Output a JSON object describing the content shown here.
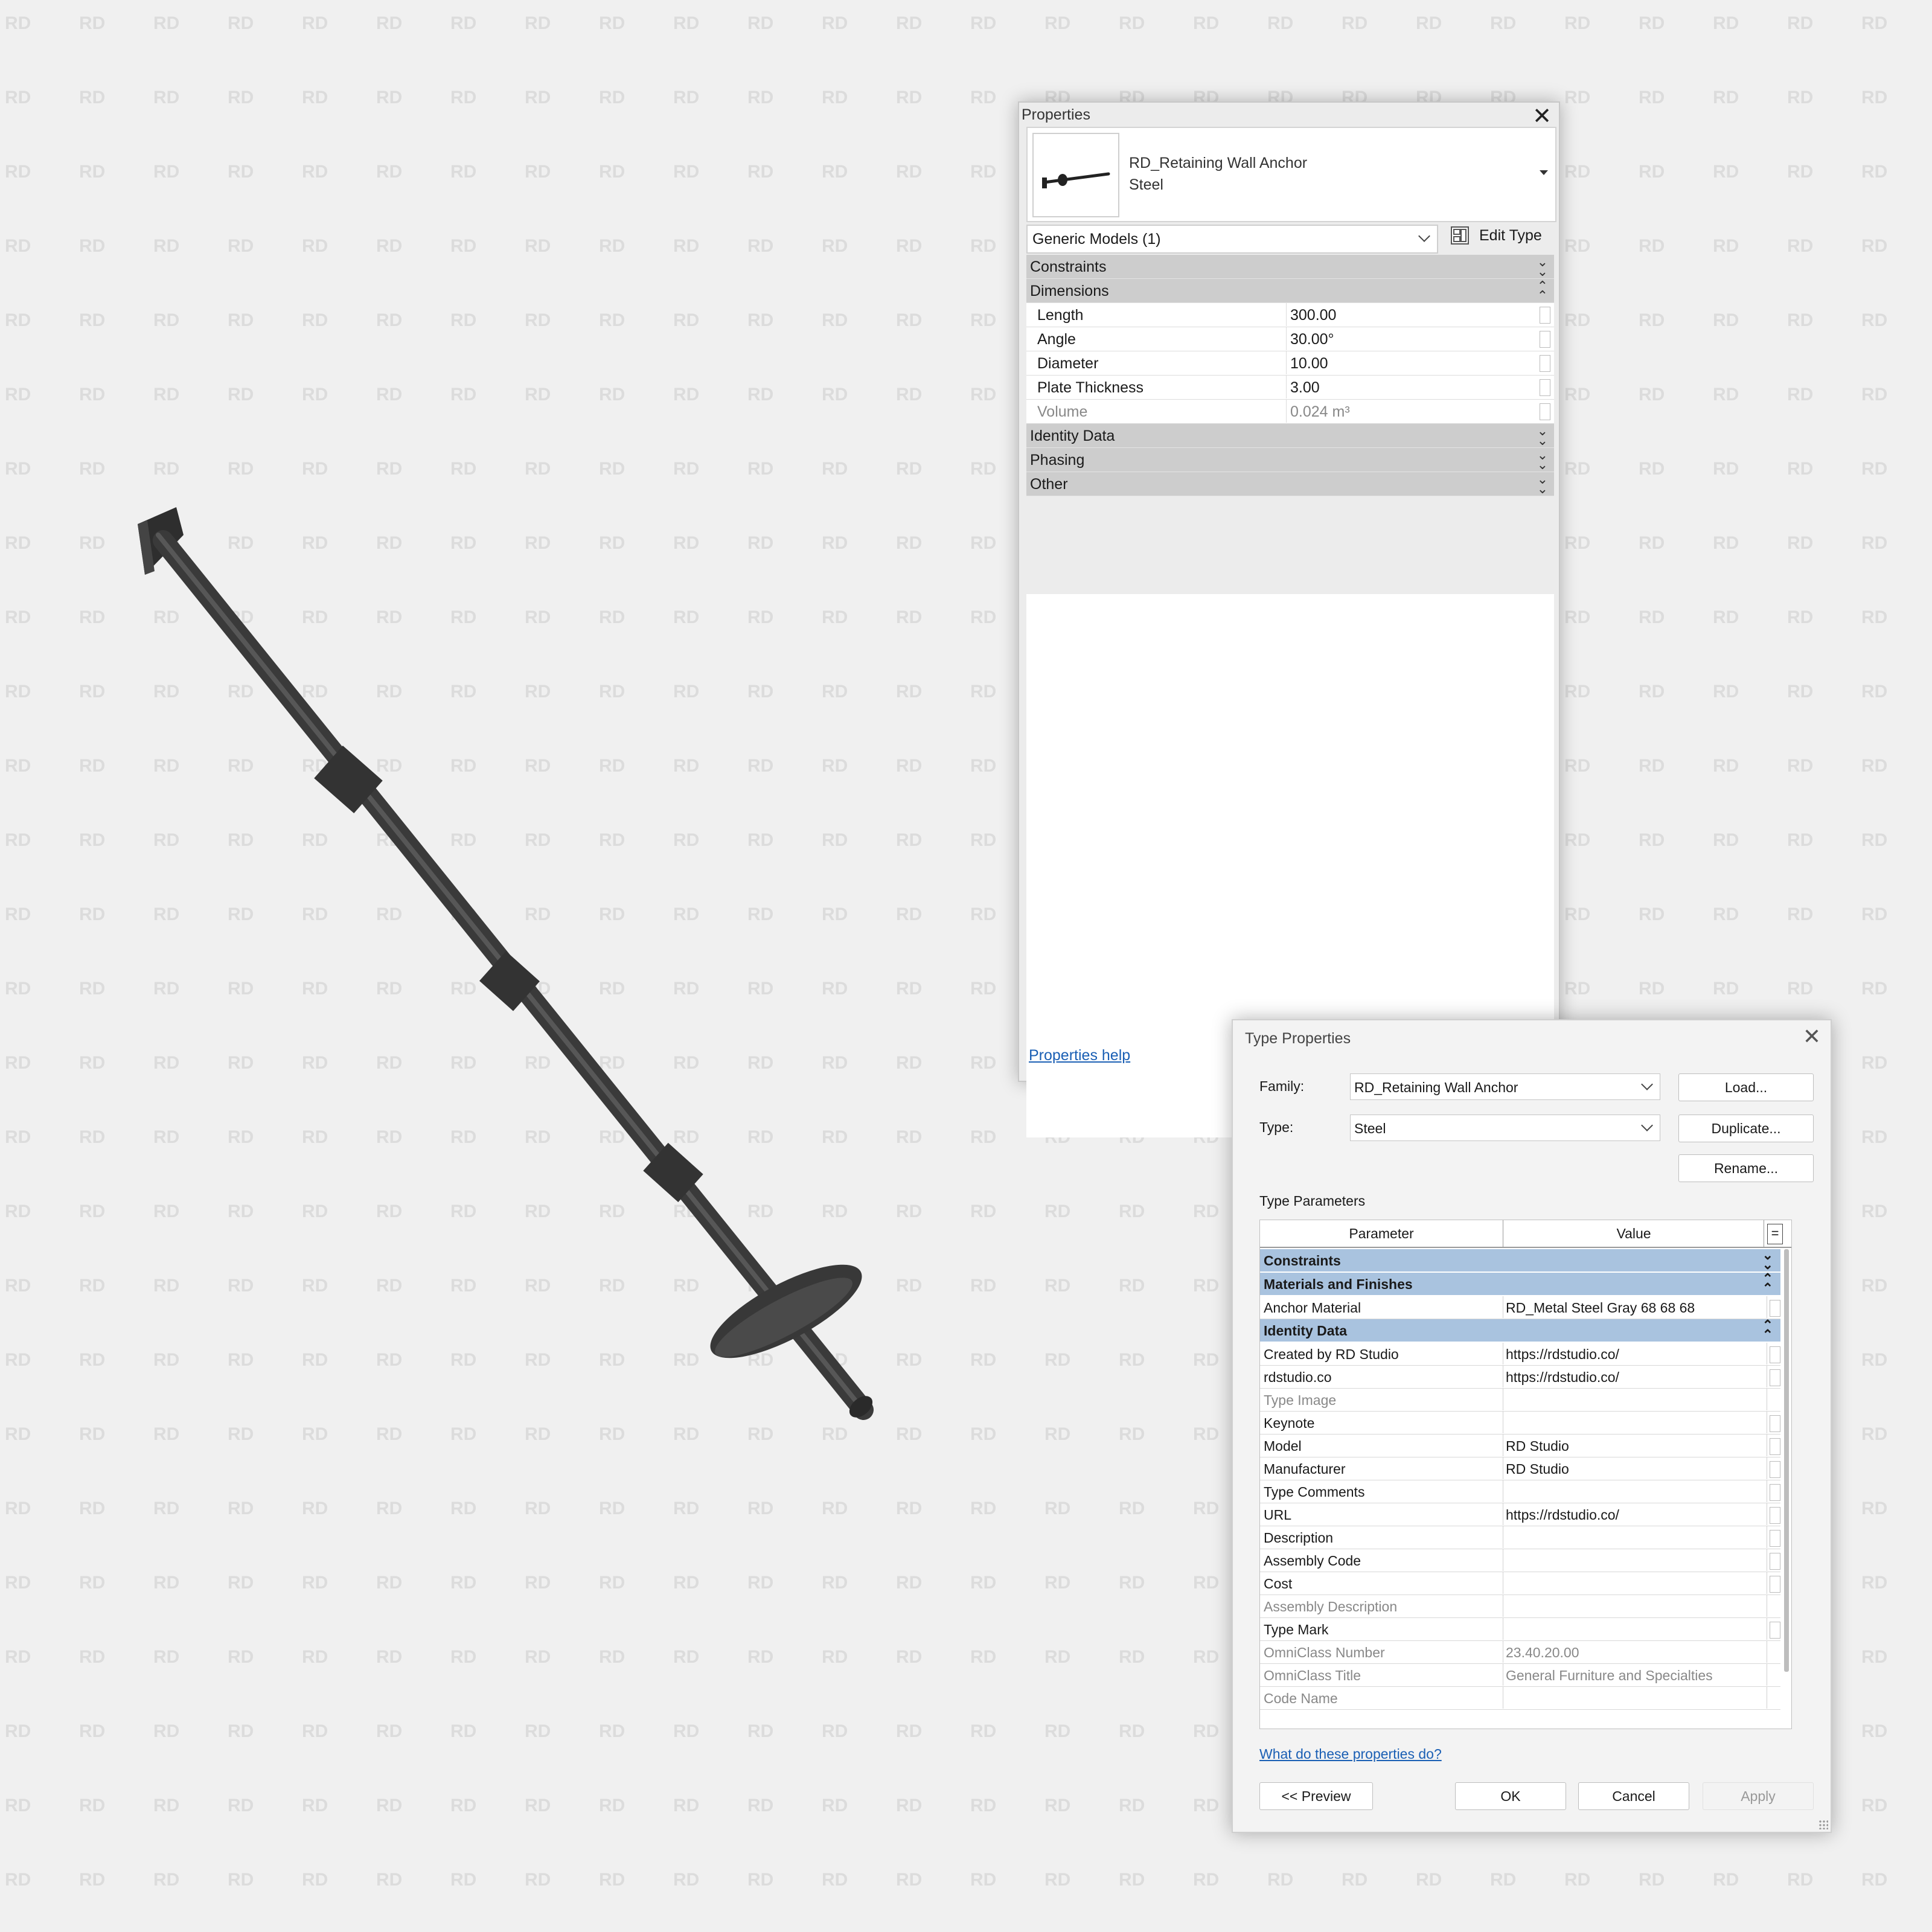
{
  "watermark_text": "RD",
  "viewport": {
    "model_color": "#3a3a3a",
    "model_highlight": "#555555"
  },
  "properties": {
    "title": "Properties",
    "type_selector": {
      "family": "RD_Retaining Wall Anchor",
      "type": "Steel"
    },
    "category_filter": "Generic Models (1)",
    "edit_type_label": "Edit Type",
    "groups": [
      {
        "label": "Constraints",
        "state": "collapsed"
      },
      {
        "label": "Dimensions",
        "state": "expanded",
        "rows": [
          {
            "name": "Length",
            "value": "300.00",
            "readonly": false
          },
          {
            "name": "Angle",
            "value": "30.00°",
            "readonly": false
          },
          {
            "name": "Diameter",
            "value": "10.00",
            "readonly": false
          },
          {
            "name": "Plate Thickness",
            "value": "3.00",
            "readonly": false
          },
          {
            "name": "Volume",
            "value": "0.024 m³",
            "readonly": true
          }
        ]
      },
      {
        "label": "Identity Data",
        "state": "collapsed"
      },
      {
        "label": "Phasing",
        "state": "collapsed"
      },
      {
        "label": "Other",
        "state": "collapsed"
      }
    ],
    "help_link": "Properties help"
  },
  "type_properties": {
    "title": "Type Properties",
    "family_label": "Family:",
    "family_value": "RD_Retaining Wall Anchor",
    "type_label": "Type:",
    "type_value": "Steel",
    "load_button": "Load...",
    "duplicate_button": "Duplicate...",
    "rename_button": "Rename...",
    "section_label": "Type Parameters",
    "col_parameter": "Parameter",
    "col_value": "Value",
    "col_equals": "=",
    "groups": [
      {
        "label": "Constraints",
        "state": "collapsed",
        "rows": []
      },
      {
        "label": "Materials and Finishes",
        "state": "expanded",
        "rows": [
          {
            "name": "Anchor Material",
            "value": "RD_Metal Steel Gray 68 68 68",
            "readonly": false
          }
        ]
      },
      {
        "label": "Identity Data",
        "state": "expanded",
        "rows": [
          {
            "name": "Created by RD Studio",
            "value": "https://rdstudio.co/",
            "readonly": false
          },
          {
            "name": "rdstudio.co",
            "value": "https://rdstudio.co/",
            "readonly": false
          },
          {
            "name": "Type Image",
            "value": "",
            "readonly": true
          },
          {
            "name": "Keynote",
            "value": "",
            "readonly": false
          },
          {
            "name": "Model",
            "value": "RD Studio",
            "readonly": false
          },
          {
            "name": "Manufacturer",
            "value": "RD Studio",
            "readonly": false
          },
          {
            "name": "Type Comments",
            "value": "",
            "readonly": false
          },
          {
            "name": "URL",
            "value": "https://rdstudio.co/",
            "readonly": false
          },
          {
            "name": "Description",
            "value": "",
            "readonly": false
          },
          {
            "name": "Assembly Code",
            "value": "",
            "readonly": false
          },
          {
            "name": "Cost",
            "value": "",
            "readonly": false
          },
          {
            "name": "Assembly Description",
            "value": "",
            "readonly": true
          },
          {
            "name": "Type Mark",
            "value": "",
            "readonly": false
          },
          {
            "name": "OmniClass Number",
            "value": "23.40.20.00",
            "readonly": true
          },
          {
            "name": "OmniClass Title",
            "value": "General Furniture and Specialties",
            "readonly": true
          },
          {
            "name": "Code Name",
            "value": "",
            "readonly": true
          }
        ]
      }
    ],
    "help_link": "What do these properties do?",
    "preview_button": "<< Preview",
    "ok_button": "OK",
    "cancel_button": "Cancel",
    "apply_button": "Apply"
  }
}
